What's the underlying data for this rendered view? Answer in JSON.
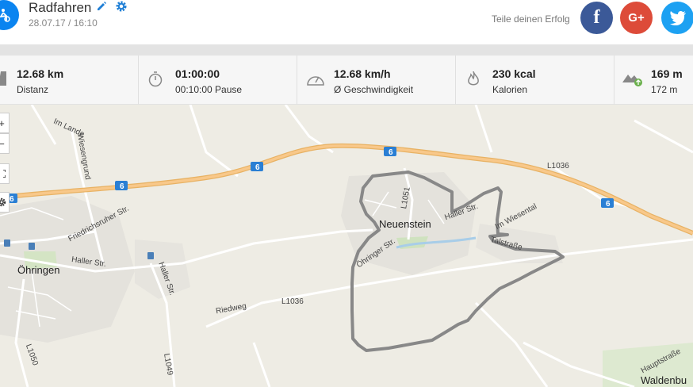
{
  "activity": {
    "title": "Radfahren",
    "datetime": "28.07.17 / 16:10",
    "icon": "bicycle-icon"
  },
  "share": {
    "label": "Teile deinen Erfolg",
    "facebook": "f",
    "googleplus": "G+",
    "colors": {
      "facebook": "#3b5998",
      "googleplus": "#dd4b39",
      "twitter": "#1da1f2"
    }
  },
  "stats": {
    "distance": {
      "value": "12.68 km",
      "label": "Distanz"
    },
    "duration": {
      "value": "01:00:00",
      "label": "00:10:00 Pause"
    },
    "speed": {
      "value": "12.68 km/h",
      "label": "Ø Geschwindigkeit"
    },
    "calories": {
      "value": "230 kcal",
      "label": "Kalorien"
    },
    "elevation": {
      "value": "169 m",
      "label": "172 m"
    }
  },
  "map": {
    "controls": {
      "zoom_in": "+",
      "zoom_out": "−"
    },
    "labels": {
      "neuenstein": "Neuenstein",
      "ohringen": "Öhringen",
      "im_lande": "Im Lande",
      "wiesengrund": "Wiesengrund",
      "friedrichsruher": "Friedrichsruher Str.",
      "haller_str_1": "Haller Str.",
      "haller_str_2": "Haller Str.",
      "haller_str_3": "Haller Str.",
      "ohringer_str": "Öhringer Str.",
      "riedweg": "Riedweg",
      "l1036_a": "L1036",
      "l1036_b": "L1036",
      "l1051": "L1051",
      "l1050": "L1050",
      "l1049": "L1049",
      "im_wiesental": "Im Wiesental",
      "talstrasse": "Talstraße",
      "hauptstrasse": "Hauptstraße",
      "waldenburg": "Waldenbu",
      "shield_6": "6"
    }
  }
}
